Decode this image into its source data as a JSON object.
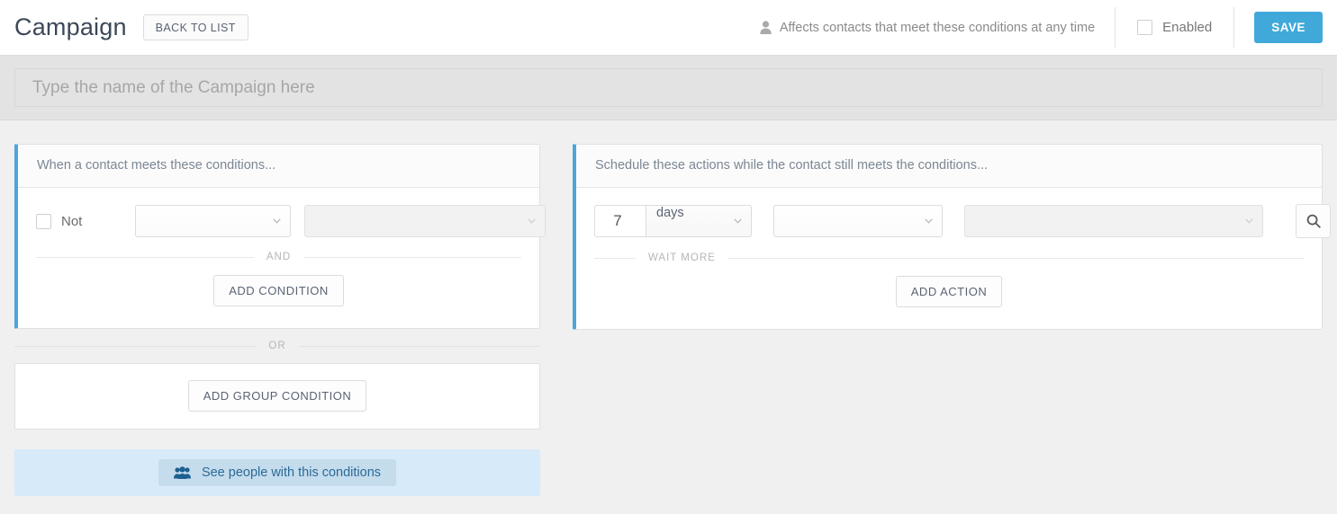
{
  "header": {
    "title": "Campaign",
    "back_button": "BACK TO LIST",
    "affects_note": "Affects contacts that meet these conditions at any time",
    "person_icon": "person-icon",
    "enabled_label": "Enabled",
    "enabled_checked": false,
    "save_button": "SAVE",
    "save_color": "#40a9d9"
  },
  "name_field": {
    "placeholder": "Type the name of the Campaign here",
    "value": ""
  },
  "conditions_panel": {
    "accent_color": "#4ca6db",
    "header": "When a contact meets these conditions...",
    "not_label": "Not",
    "not_checked": false,
    "field_select_value": "",
    "operator_select_value": "",
    "operator_disabled": true,
    "and_separator": "AND",
    "add_condition_button": "ADD CONDITION"
  },
  "group": {
    "or_separator": "OR",
    "add_group_condition_button": "ADD GROUP CONDITION"
  },
  "see_people": {
    "label": "See people with this conditions",
    "icon": "people-icon",
    "background": "#d6eafa",
    "chip_background": "#c5dced"
  },
  "actions_panel": {
    "accent_color": "#4ca6db",
    "header": "Schedule these actions while the contact still meets the conditions...",
    "wait_value": "7",
    "wait_unit": "days",
    "action_select_value": "",
    "target_select_value": "",
    "target_disabled": true,
    "search_icon": "search-icon",
    "wait_more_separator": "WAIT MORE",
    "add_action_button": "ADD ACTION"
  }
}
